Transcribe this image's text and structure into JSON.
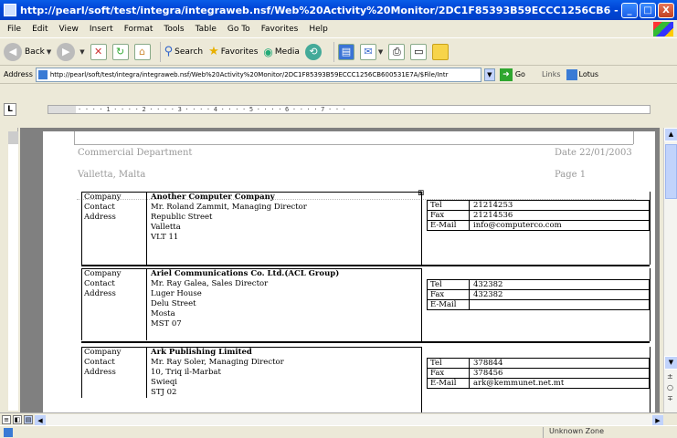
{
  "window": {
    "title": "http://pearl/soft/test/integra/integraweb.nsf/Web%20Activity%20Monitor/2DC1F85393B59ECCC1256CB6 - Microsoft Intern...",
    "min": "_",
    "max": "□",
    "close": "X"
  },
  "menu": [
    "File",
    "Edit",
    "View",
    "Insert",
    "Format",
    "Tools",
    "Table",
    "Go To",
    "Favorites",
    "Help"
  ],
  "toolbar": {
    "back": "Back",
    "search": "Search",
    "favorites": "Favorites",
    "media": "Media"
  },
  "address": {
    "label": "Address",
    "url": "http://pearl/soft/test/integra/integraweb.nsf/Web%20Activity%20Monitor/2DC1F85393B59ECCC1256CB600531E7A/$File/Intr",
    "go": "Go",
    "links": "Links",
    "lotus": "Lotus"
  },
  "ruler": {
    "tab_selector": "L",
    "marks": "·  ·  ·  ·  1  ·  ·  ·  ·  2  ·  ·  ·  ·  3  ·  ·  ·  ·  4  ·  ·  ·  ·  5  ·  ·  ·  ·  6  ·  ·  ·  ·  7  ·  ·  ·"
  },
  "document": {
    "header": {
      "dept": "Commercial Department",
      "location": "Valletta, Malta",
      "date": "Date 22/01/2003",
      "page": "Page 1"
    },
    "labels": {
      "company": "Company",
      "contact": "Contact",
      "address": "Address",
      "tel": "Tel",
      "fax": "Fax",
      "email": "E-Mail"
    },
    "entries": [
      {
        "company": "Another Computer Company",
        "contact": "Mr. Roland Zammit, Managing Director",
        "address": [
          "Republic Street",
          "Valletta",
          "VLT 11"
        ],
        "tel": "21214253",
        "fax": "21214536",
        "email": "info@computerco.com"
      },
      {
        "company": "Ariel Communications Co. Ltd.(ACL Group)",
        "contact": "Mr. Ray Galea, Sales Director",
        "address": [
          "Luger House",
          "Delu Street",
          "Mosta",
          "MST 07"
        ],
        "tel": "432382",
        "fax": "432382",
        "email": ""
      },
      {
        "company": "Ark Publishing Limited",
        "contact": "Mr. Ray Soler, Managing Director",
        "address": [
          "10, Triq il-Marbat",
          "Swieqi",
          "STJ 02"
        ],
        "tel": "378844",
        "fax": "378456",
        "email": "ark@kemmunet.net.mt"
      }
    ]
  },
  "status": {
    "zone": "Unknown Zone"
  }
}
